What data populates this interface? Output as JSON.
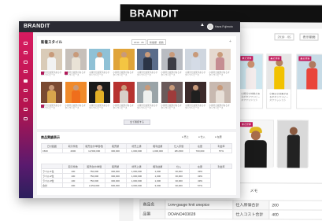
{
  "back_window": {
    "brand": "BRANDIT",
    "date_filter": "2019 · 05",
    "sort_filter": "表示期間",
    "cards": [
      {
        "tag": "最近登録",
        "caption": "小顔見せ效果があるボタンワンピースファッション"
      },
      {
        "tag": "最近登録",
        "caption": "小顔見せ效果があるボタンワンピースファッション"
      },
      {
        "tag": "最近登録",
        "caption": ""
      },
      {
        "tag": "最近登録",
        "caption": ""
      }
    ],
    "memo_label": "メモ",
    "table": [
      {
        "k1": "商品名",
        "v1": "Low-gauge knit onepice",
        "k2": "仕入原価合計",
        "v2": "200"
      },
      {
        "k1": "品番",
        "v1": "DOANO403028",
        "k2": "仕入コスト合計",
        "v2": "400"
      }
    ]
  },
  "front_window": {
    "brand": "BRANDIT",
    "user_name": "Hana Fujimoto",
    "section1_title": "新着スタイル",
    "filter_period": "2019 · 05",
    "filter_sort": "新着順 · 投稿",
    "add_label": "+",
    "photos": [
      {
        "bg": "#d9cbb8",
        "body": "#f2f2f2",
        "caption": "小顔見せ效果があるボタンワンピース"
      },
      {
        "bg": "#c7c0ba",
        "body": "#e9e2d6",
        "caption": "小顔見せ效果があるボタンワンピース"
      },
      {
        "bg": "#8fc1d6",
        "body": "#ffffff",
        "caption": "小顔見せ效果があるボタンワンピース"
      },
      {
        "bg": "#e0a43a",
        "body": "#f4c542",
        "caption": "小顔見せ效果があるボタンワンピース"
      },
      {
        "bg": "#5a6c8a",
        "body": "#2b3446",
        "caption": "小顔見せ效果があるボタンワンピース"
      },
      {
        "bg": "#b9bcc2",
        "body": "#3c3c44",
        "caption": "小顔見せ效果があるボタンワンピース"
      },
      {
        "bg": "#cfd6df",
        "body": "#d4dbe6",
        "caption": "小顔見せ效果があるボタンワンピース"
      },
      {
        "bg": "#e5d9cf",
        "body": "#c58d92",
        "caption": "小顔見せ效果があるボタンワンピース"
      },
      {
        "bg": "#7a4a32",
        "body": "#d8a54c",
        "caption": "小顔見せ效果があるボタンワンピース"
      },
      {
        "bg": "#f08a2a",
        "body": "#ef6e1c",
        "caption": "小顔見せ效果があるボタンワンピース"
      },
      {
        "bg": "#1a1a1a",
        "body": "#e3b026",
        "caption": "小顔見せ效果があるボタンワンピース"
      },
      {
        "bg": "#b7322f",
        "body": "#d8cfc8",
        "caption": "小顔見せ效果があるボタンワンピース"
      },
      {
        "bg": "#9aa4a8",
        "body": "#eef0ee",
        "caption": "小顔見せ效果があるボタンワンピース"
      },
      {
        "bg": "#6a5a5a",
        "body": "#9e3b3b",
        "caption": "小顔見せ效果があるボタンワンピース"
      },
      {
        "bg": "#3b2a2a",
        "body": "#1f1f1f",
        "caption": "小顔見せ效果があるボタンワンピース"
      },
      {
        "bg": "#c8b9b0",
        "body": "#e8e0d8",
        "caption": "小顔見せ效果があるボタンワンピース"
      }
    ],
    "more_button": "全て確認する",
    "section2_title": "商品実績表示",
    "legend": [
      "● 売上",
      "● 仕入",
      "● 在庫"
    ],
    "grid1_headers": [
      "日付範囲",
      "取引件数",
      "販売合計/単価/数",
      "販売額",
      "総売上額",
      "粗利益額",
      "仕入原価",
      "在庫",
      "利益率"
    ],
    "grid1_row": [
      "1500",
      "2000",
      "12,500,000",
      "300,000",
      "1,000,000",
      "1,000,000",
      "281,800",
      "700,000",
      "57%"
    ],
    "grid2_headers": [
      "",
      "取引件数",
      "販売合計/単価",
      "販売額",
      "総売上額",
      "粗利益額",
      "仕入",
      "在庫",
      "利益率"
    ],
    "grid2_rows": [
      [
        "ラベル/1位",
        "100",
        "750,000",
        "300,000",
        "1,000,000",
        "1,000",
        "30,000",
        "49%"
      ],
      [
        "ラベル/2位",
        "100",
        "750,000",
        "300,000",
        "1,000,000",
        "1,000",
        "30,000",
        "49%"
      ],
      [
        "ラベル/3位",
        "100",
        "750,000",
        "300,000",
        "1,000,000",
        "1,000",
        "30,000",
        "49%"
      ],
      [
        "合計",
        "400",
        "2,250,000",
        "900,000",
        "3,000,000",
        "3,000",
        "90,000",
        "57%"
      ]
    ],
    "fab_label": "+"
  }
}
